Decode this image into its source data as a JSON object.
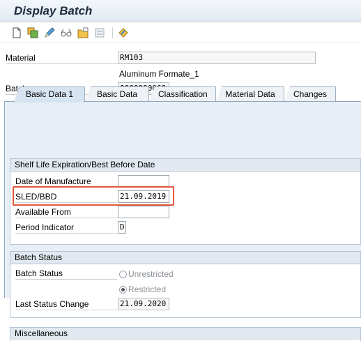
{
  "window": {
    "title": "Display Batch"
  },
  "toolbar": {
    "icons": [
      "new-document-icon",
      "copy-icon",
      "edit-pencil-icon",
      "display-glasses-icon",
      "folder-icon",
      "print-layout-icon",
      "other-object-icon"
    ]
  },
  "header": {
    "material_label": "Material",
    "material_value": "RM103",
    "material_description": "Aluminum Formate_1",
    "batch_label": "Batch",
    "batch_value": "0000000069"
  },
  "tabs": [
    {
      "label": "Basic Data 1",
      "active": true
    },
    {
      "label": "Basic Data 2",
      "active": false
    },
    {
      "label": "Classification",
      "active": false
    },
    {
      "label": "Material Data",
      "active": false
    },
    {
      "label": "Changes",
      "active": false
    }
  ],
  "shelf_life": {
    "title": "Shelf Life Expiration/Best Before Date",
    "date_of_manufacture_label": "Date of Manufacture",
    "date_of_manufacture_value": "",
    "sled_bbd_label": "SLED/BBD",
    "sled_bbd_value": "21.09.2019",
    "available_from_label": "Available From",
    "available_from_value": "",
    "period_indicator_label": "Period Indicator",
    "period_indicator_value": "D"
  },
  "batch_status": {
    "title": "Batch Status",
    "status_label": "Batch Status",
    "options": [
      {
        "label": "Unrestricted",
        "selected": false
      },
      {
        "label": "Restricted",
        "selected": true
      }
    ],
    "last_change_label": "Last Status Change",
    "last_change_value": "21.09.2020"
  },
  "miscellaneous": {
    "title": "Miscellaneous"
  },
  "colors": {
    "highlight": "#e0573a",
    "tab_active": "#d6e3f1",
    "panel_bg": "#e7eef6"
  }
}
